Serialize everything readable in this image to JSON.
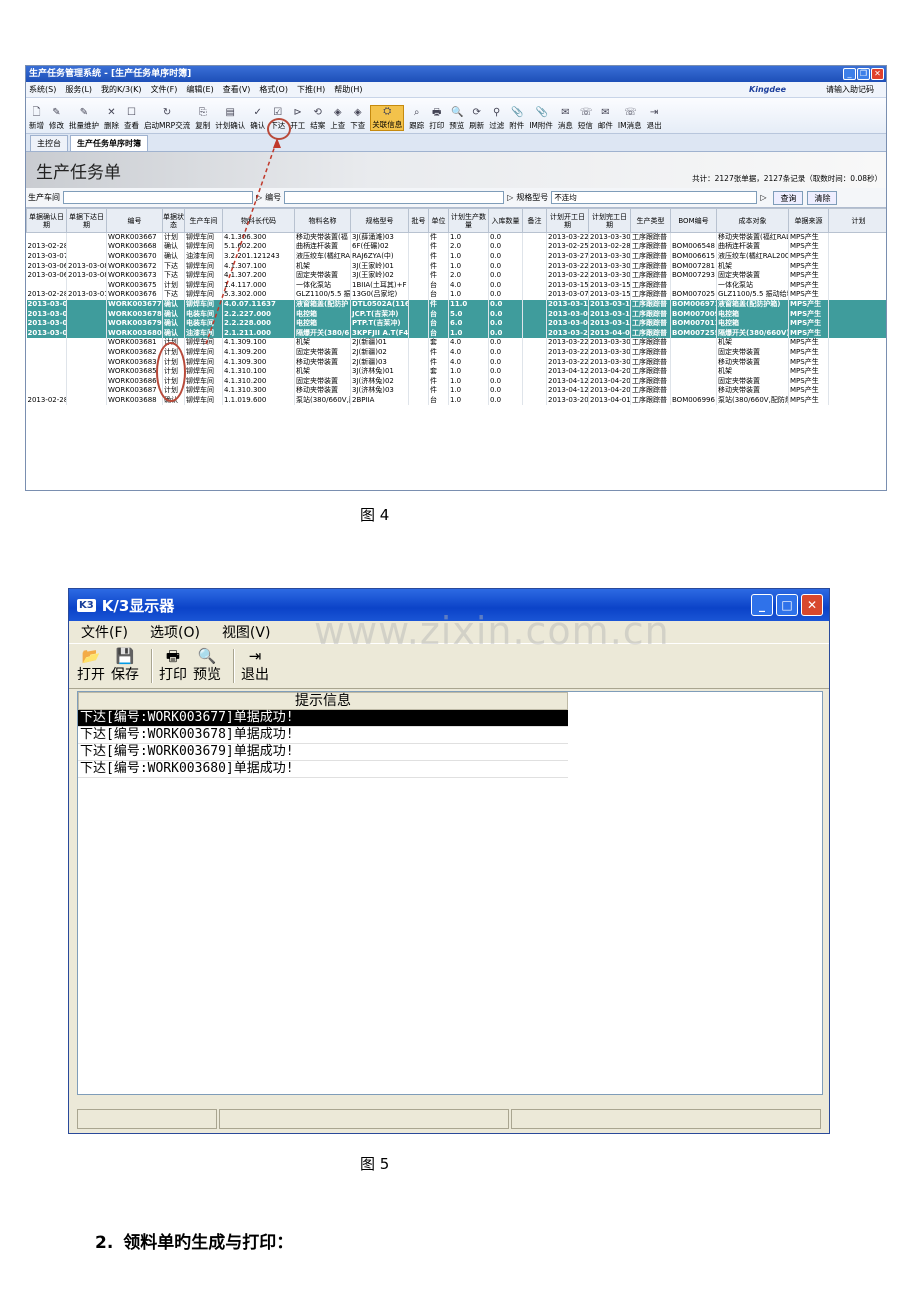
{
  "fig4": {
    "window_title": "生产任务管理系统 - [生产任务单序时簿]",
    "menus": [
      "系统(S)",
      "服务(L)",
      "我的K/3(K)",
      "文件(F)",
      "编辑(E)",
      "查看(V)",
      "格式(O)",
      "下推(H)",
      "帮助(H)"
    ],
    "brand": "Kingdee",
    "help_text": "请输入助记码",
    "toolbar": [
      "新增",
      "修改",
      "批量维护",
      "删除",
      "查看",
      "启动MRP交流",
      "复制",
      "计划确认",
      "确认",
      "下达",
      "开工",
      "结案",
      "上查",
      "下查",
      "关联信息",
      "跟踪",
      "打印",
      "预览",
      "刷新",
      "过滤",
      "附件",
      "IM附件",
      "消息",
      "短信",
      "邮件",
      "IM消息",
      "退出"
    ],
    "toolbar_highlight": "关联信息",
    "tabs": [
      "主控台",
      "生产任务单序时簿"
    ],
    "banner_title": "生产任务单",
    "stats": "共计：2127张单据，2127条记录（取数时间：0.08秒）",
    "filter": {
      "workshop_label": "生产车间",
      "number_label": "编号",
      "spec_label": "规格型号",
      "spec_value": "不连均",
      "query": "查询",
      "clear": "清除"
    },
    "columns": [
      "单据确认日期",
      "单据下达日期",
      "编号",
      "单据状态",
      "生产车间",
      "物料长代码",
      "物料名称",
      "规格型号",
      "批号",
      "单位",
      "计划生产数量",
      "入库数量",
      "备注",
      "计划开工日期",
      "计划完工日期",
      "生产类型",
      "BOM编号",
      "成本对象",
      "单据来源",
      "计划"
    ],
    "rows": [
      [
        "",
        "",
        "WORK003667",
        "计划",
        "铆焊车间",
        "4.1.306.300",
        "移动夹带装置(福",
        "3J(薛涌滩)03",
        "",
        "件",
        "1.0",
        "0.0",
        "",
        "2013-03-22",
        "2013-03-30",
        "工序跟踪普",
        "",
        "移动夹带装置(福红RAL",
        "MPS产生",
        ""
      ],
      [
        "2013-02-28",
        "",
        "WORK003668",
        "确认",
        "铆焊车间",
        "5.1.602.200",
        "曲柄连杆装置",
        "6F(任碾)02",
        "",
        "件",
        "2.0",
        "0.0",
        "",
        "2013-02-25",
        "2013-02-28",
        "工序跟踪普",
        "BOM006548",
        "曲柄连杆装置",
        "MPS产生",
        ""
      ],
      [
        "2013-03-07",
        "",
        "WORK003670",
        "确认",
        "油漆车间",
        "3.2.201.121243",
        "液压绞车(橘红RAL",
        "RAJ6ZYA(中)",
        "",
        "件",
        "1.0",
        "0.0",
        "",
        "2013-03-27",
        "2013-03-30",
        "工序跟踪普",
        "BOM006615",
        "液压绞车(橘红RAL2001",
        "MPS产生",
        ""
      ],
      [
        "2013-03-06",
        "2013-03-08",
        "WORK003672",
        "下达",
        "铆焊车间",
        "4.1.307.100",
        "机架",
        "3J(王家岭)01",
        "",
        "件",
        "1.0",
        "0.0",
        "",
        "2013-03-22",
        "2013-03-30",
        "工序跟踪普",
        "BOM007281",
        "机架",
        "MPS产生",
        ""
      ],
      [
        "2013-03-06",
        "2013-03-08",
        "WORK003673",
        "下达",
        "铆焊车间",
        "4.1.307.200",
        "固定夹带装置",
        "3J(王家岭)02",
        "",
        "件",
        "2.0",
        "0.0",
        "",
        "2013-03-22",
        "2013-03-30",
        "工序跟踪普",
        "BOM007293",
        "固定夹带装置",
        "MPS产生",
        ""
      ],
      [
        "",
        "",
        "WORK003675",
        "计划",
        "铆焊车间",
        "1.4.117.000",
        "一体化泵站",
        "1BIIA(土耳其)+F",
        "",
        "台",
        "4.0",
        "0.0",
        "",
        "2013-03-15",
        "2013-03-15",
        "工序跟踪普",
        "",
        "一体化泵站",
        "MPS产生",
        ""
      ],
      [
        "2013-02-28",
        "2013-03-01",
        "WORK003676",
        "下达",
        "铆焊车间",
        "5.3.302.000",
        "GLZ1100/5.5 振动",
        "13G0(吕家坨)",
        "",
        "台",
        "1.0",
        "0.0",
        "",
        "2013-03-07",
        "2013-03-15",
        "工序跟踪普",
        "BOM007025",
        "GLZ1100/5.5 振动给料",
        "MPS产生",
        ""
      ],
      [
        "2013-03-0",
        "",
        "WORK003677",
        "确认",
        "铆焊车间",
        "4.0.07.11637",
        "液窗箱盖(配防护",
        "DTL0502A(1163",
        "",
        "件",
        "11.0",
        "0.0",
        "",
        "2013-03-11",
        "2013-03-1",
        "工序跟踪普",
        "BOM006971",
        "液窗箱盖(配防护箱)",
        "MPS产生",
        ""
      ],
      [
        "2013-03-0",
        "",
        "WORK003678",
        "确认",
        "电装车间",
        "2.2.227.000",
        "电控箱",
        "JCP.T(吉茉冲)",
        "",
        "台",
        "5.0",
        "0.0",
        "",
        "2013-03-08",
        "2013-03-1",
        "工序跟踪普",
        "BOM007009",
        "电控箱",
        "MPS产生",
        ""
      ],
      [
        "2013-03-0",
        "",
        "WORK003679",
        "确认",
        "电装车间",
        "2.2.228.000",
        "电控箱",
        "PTP.T(吉茉冲)",
        "",
        "台",
        "6.0",
        "0.0",
        "",
        "2013-03-08",
        "2013-03-1",
        "工序跟踪普",
        "BOM007011",
        "电控箱",
        "MPS产生",
        ""
      ],
      [
        "2013-03-0",
        "",
        "WORK003680",
        "确认",
        "油漆车间",
        "2.1.211.000",
        "隔爆开关(380/6",
        "3KPFJII A.T(F4",
        "",
        "台",
        "1.0",
        "0.0",
        "",
        "2013-03-20",
        "2013-04-0",
        "工序跟踪普",
        "BOM007255",
        "隔爆开关(380/660V)",
        "MPS产生",
        ""
      ],
      [
        "",
        "",
        "WORK003681",
        "计划",
        "铆焊车间",
        "4.1.309.100",
        "机架",
        "2J(新疆)01",
        "",
        "套",
        "4.0",
        "0.0",
        "",
        "2013-03-22",
        "2013-03-30",
        "工序跟踪普",
        "",
        "机架",
        "MPS产生",
        ""
      ],
      [
        "",
        "",
        "WORK003682",
        "计划",
        "铆焊车间",
        "4.1.309.200",
        "固定夹带装置",
        "2J(新疆)02",
        "",
        "件",
        "4.0",
        "0.0",
        "",
        "2013-03-22",
        "2013-03-30",
        "工序跟踪普",
        "",
        "固定夹带装置",
        "MPS产生",
        ""
      ],
      [
        "",
        "",
        "WORK003683",
        "计划",
        "铆焊车间",
        "4.1.309.300",
        "移动夹带装置",
        "2J(新疆)03",
        "",
        "件",
        "4.0",
        "0.0",
        "",
        "2013-03-22",
        "2013-03-30",
        "工序跟踪普",
        "",
        "移动夹带装置",
        "MPS产生",
        ""
      ],
      [
        "",
        "",
        "WORK003685",
        "计划",
        "铆焊车间",
        "4.1.310.100",
        "机架",
        "3J(济林兔)01",
        "",
        "套",
        "1.0",
        "0.0",
        "",
        "2013-04-12",
        "2013-04-20",
        "工序跟踪普",
        "",
        "机架",
        "MPS产生",
        ""
      ],
      [
        "",
        "",
        "WORK003686",
        "计划",
        "铆焊车间",
        "4.1.310.200",
        "固定夹带装置",
        "3J(济林兔)02",
        "",
        "件",
        "1.0",
        "0.0",
        "",
        "2013-04-12",
        "2013-04-20",
        "工序跟踪普",
        "",
        "固定夹带装置",
        "MPS产生",
        ""
      ],
      [
        "",
        "",
        "WORK003687",
        "计划",
        "铆焊车间",
        "4.1.310.300",
        "移动夹带装置",
        "3J(济林兔)03",
        "",
        "件",
        "1.0",
        "0.0",
        "",
        "2013-04-12",
        "2013-04-20",
        "工序跟踪普",
        "",
        "移动夹带装置",
        "MPS产生",
        ""
      ],
      [
        "2013-02-28",
        "",
        "WORK003688",
        "确认",
        "铆焊车间",
        "1.1.019.600",
        "泵站(380/660V,配",
        "2BPIIA",
        "",
        "台",
        "1.0",
        "0.0",
        "",
        "2013-03-20",
        "2013-04-01",
        "工序跟踪普",
        "BOM006996",
        "泵站(380/660V,配防爆",
        "MPS产生",
        ""
      ]
    ],
    "caption": "图 4"
  },
  "fig5": {
    "title": "K/3显示器",
    "logo": "K3",
    "menus": [
      "文件(F)",
      "选项(O)",
      "视图(V)"
    ],
    "toolbar": [
      "打开",
      "保存",
      "打印",
      "预览",
      "退出"
    ],
    "header": "提示信息",
    "messages": [
      "下达[编号:WORK003677]单据成功!",
      "下达[编号:WORK003678]单据成功!",
      "下达[编号:WORK003679]单据成功!",
      "下达[编号:WORK003680]单据成功!"
    ],
    "watermark": "www.zixin.com.cn",
    "caption": "图 5"
  },
  "section": {
    "number": "2.",
    "title": "领料单旳生成与打印："
  }
}
